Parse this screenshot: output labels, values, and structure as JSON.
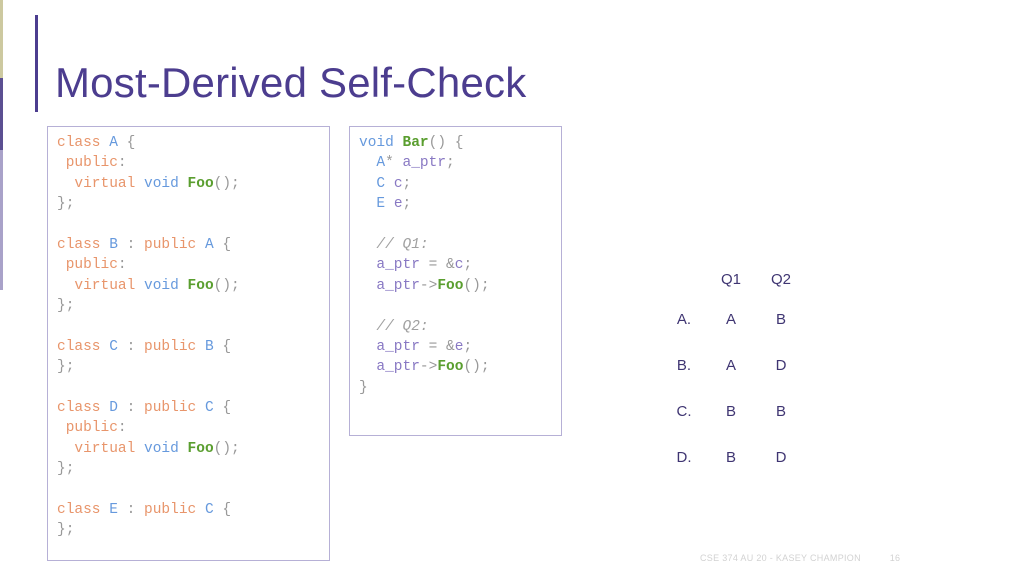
{
  "slide": {
    "title": "Most-Derived Self-Check",
    "title_color": "#4c3d8f",
    "accent_color": "#4c3d8f",
    "background_color": "#ffffff"
  },
  "edge_strip": {
    "olive_color": "#cdc9a0",
    "dark_purple_color": "#5b4f92",
    "light_purple_color": "#a9a2c9"
  },
  "code_box_classes": {
    "border_color": "#b6b0d6",
    "lines": [
      [
        {
          "t": "class ",
          "c": "key"
        },
        {
          "t": "A",
          "c": "type"
        },
        {
          "t": " {",
          "c": "pun"
        }
      ],
      [
        {
          "t": " public",
          "c": "key"
        },
        {
          "t": ":",
          "c": "pun"
        }
      ],
      [
        {
          "t": "  ",
          "c": "pun"
        },
        {
          "t": "virtual ",
          "c": "key"
        },
        {
          "t": "void ",
          "c": "type"
        },
        {
          "t": "Foo",
          "c": "fn"
        },
        {
          "t": "();",
          "c": "pun"
        }
      ],
      [
        {
          "t": "};",
          "c": "pun"
        }
      ],
      [
        {
          "t": "",
          "c": "pun"
        }
      ],
      [
        {
          "t": "class ",
          "c": "key"
        },
        {
          "t": "B",
          "c": "type"
        },
        {
          "t": " : ",
          "c": "pun"
        },
        {
          "t": "public ",
          "c": "key"
        },
        {
          "t": "A",
          "c": "type"
        },
        {
          "t": " {",
          "c": "pun"
        }
      ],
      [
        {
          "t": " public",
          "c": "key"
        },
        {
          "t": ":",
          "c": "pun"
        }
      ],
      [
        {
          "t": "  ",
          "c": "pun"
        },
        {
          "t": "virtual ",
          "c": "key"
        },
        {
          "t": "void ",
          "c": "type"
        },
        {
          "t": "Foo",
          "c": "fn"
        },
        {
          "t": "();",
          "c": "pun"
        }
      ],
      [
        {
          "t": "};",
          "c": "pun"
        }
      ],
      [
        {
          "t": "",
          "c": "pun"
        }
      ],
      [
        {
          "t": "class ",
          "c": "key"
        },
        {
          "t": "C",
          "c": "type"
        },
        {
          "t": " : ",
          "c": "pun"
        },
        {
          "t": "public ",
          "c": "key"
        },
        {
          "t": "B",
          "c": "type"
        },
        {
          "t": " {",
          "c": "pun"
        }
      ],
      [
        {
          "t": "};",
          "c": "pun"
        }
      ],
      [
        {
          "t": "",
          "c": "pun"
        }
      ],
      [
        {
          "t": "class ",
          "c": "key"
        },
        {
          "t": "D",
          "c": "type"
        },
        {
          "t": " : ",
          "c": "pun"
        },
        {
          "t": "public ",
          "c": "key"
        },
        {
          "t": "C",
          "c": "type"
        },
        {
          "t": " {",
          "c": "pun"
        }
      ],
      [
        {
          "t": " public",
          "c": "key"
        },
        {
          "t": ":",
          "c": "pun"
        }
      ],
      [
        {
          "t": "  ",
          "c": "pun"
        },
        {
          "t": "virtual ",
          "c": "key"
        },
        {
          "t": "void ",
          "c": "type"
        },
        {
          "t": "Foo",
          "c": "fn"
        },
        {
          "t": "();",
          "c": "pun"
        }
      ],
      [
        {
          "t": "};",
          "c": "pun"
        }
      ],
      [
        {
          "t": "",
          "c": "pun"
        }
      ],
      [
        {
          "t": "class ",
          "c": "key"
        },
        {
          "t": "E",
          "c": "type"
        },
        {
          "t": " : ",
          "c": "pun"
        },
        {
          "t": "public ",
          "c": "key"
        },
        {
          "t": "C",
          "c": "type"
        },
        {
          "t": " {",
          "c": "pun"
        }
      ],
      [
        {
          "t": "};",
          "c": "pun"
        }
      ]
    ],
    "plain_text": "class A {\n public:\n  virtual void Foo();\n};\n\nclass B : public A {\n public:\n  virtual void Foo();\n};\n\nclass C : public B {\n};\n\nclass D : public C {\n public:\n  virtual void Foo();\n};\n\nclass E : public C {\n};"
  },
  "code_box_bar": {
    "border_color": "#b6b0d6",
    "lines": [
      [
        {
          "t": "void ",
          "c": "type"
        },
        {
          "t": "Bar",
          "c": "fn"
        },
        {
          "t": "() {",
          "c": "pun"
        }
      ],
      [
        {
          "t": "  ",
          "c": "pun"
        },
        {
          "t": "A",
          "c": "type"
        },
        {
          "t": "* ",
          "c": "pun"
        },
        {
          "t": "a_ptr",
          "c": "var"
        },
        {
          "t": ";",
          "c": "pun"
        }
      ],
      [
        {
          "t": "  ",
          "c": "pun"
        },
        {
          "t": "C",
          "c": "type"
        },
        {
          "t": " ",
          "c": "pun"
        },
        {
          "t": "c",
          "c": "var"
        },
        {
          "t": ";",
          "c": "pun"
        }
      ],
      [
        {
          "t": "  ",
          "c": "pun"
        },
        {
          "t": "E",
          "c": "type"
        },
        {
          "t": " ",
          "c": "pun"
        },
        {
          "t": "e",
          "c": "var"
        },
        {
          "t": ";",
          "c": "pun"
        }
      ],
      [
        {
          "t": "",
          "c": "pun"
        }
      ],
      [
        {
          "t": "  ",
          "c": "pun"
        },
        {
          "t": "// Q1:",
          "c": "cmt"
        }
      ],
      [
        {
          "t": "  ",
          "c": "pun"
        },
        {
          "t": "a_ptr",
          "c": "var"
        },
        {
          "t": " = &",
          "c": "pun"
        },
        {
          "t": "c",
          "c": "var"
        },
        {
          "t": ";",
          "c": "pun"
        }
      ],
      [
        {
          "t": "  ",
          "c": "pun"
        },
        {
          "t": "a_ptr",
          "c": "var"
        },
        {
          "t": "->",
          "c": "pun"
        },
        {
          "t": "Foo",
          "c": "fn"
        },
        {
          "t": "();",
          "c": "pun"
        }
      ],
      [
        {
          "t": "",
          "c": "pun"
        }
      ],
      [
        {
          "t": "  ",
          "c": "pun"
        },
        {
          "t": "// Q2:",
          "c": "cmt"
        }
      ],
      [
        {
          "t": "  ",
          "c": "pun"
        },
        {
          "t": "a_ptr",
          "c": "var"
        },
        {
          "t": " = &",
          "c": "pun"
        },
        {
          "t": "e",
          "c": "var"
        },
        {
          "t": ";",
          "c": "pun"
        }
      ],
      [
        {
          "t": "  ",
          "c": "pun"
        },
        {
          "t": "a_ptr",
          "c": "var"
        },
        {
          "t": "->",
          "c": "pun"
        },
        {
          "t": "Foo",
          "c": "fn"
        },
        {
          "t": "();",
          "c": "pun"
        }
      ],
      [
        {
          "t": "}",
          "c": "pun"
        }
      ]
    ],
    "plain_text": "void Bar() {\n  A* a_ptr;\n  C c;\n  E e;\n\n  // Q1:\n  a_ptr = &c;\n  a_ptr->Foo();\n\n  // Q2:\n  a_ptr = &e;\n  a_ptr->Foo();\n}"
  },
  "answer_table": {
    "headers": [
      "",
      "Q1",
      "Q2"
    ],
    "rows": [
      {
        "label": "A.",
        "q1": "A",
        "q2": "B"
      },
      {
        "label": "B.",
        "q1": "A",
        "q2": "D"
      },
      {
        "label": "C.",
        "q1": "B",
        "q2": "B"
      },
      {
        "label": "D.",
        "q1": "B",
        "q2": "D"
      }
    ],
    "text_color": "#3f3572"
  },
  "footer": {
    "text": "CSE 374 AU 20 - KASEY CHAMPION",
    "page_number": "16",
    "color": "#d2d2d2"
  }
}
